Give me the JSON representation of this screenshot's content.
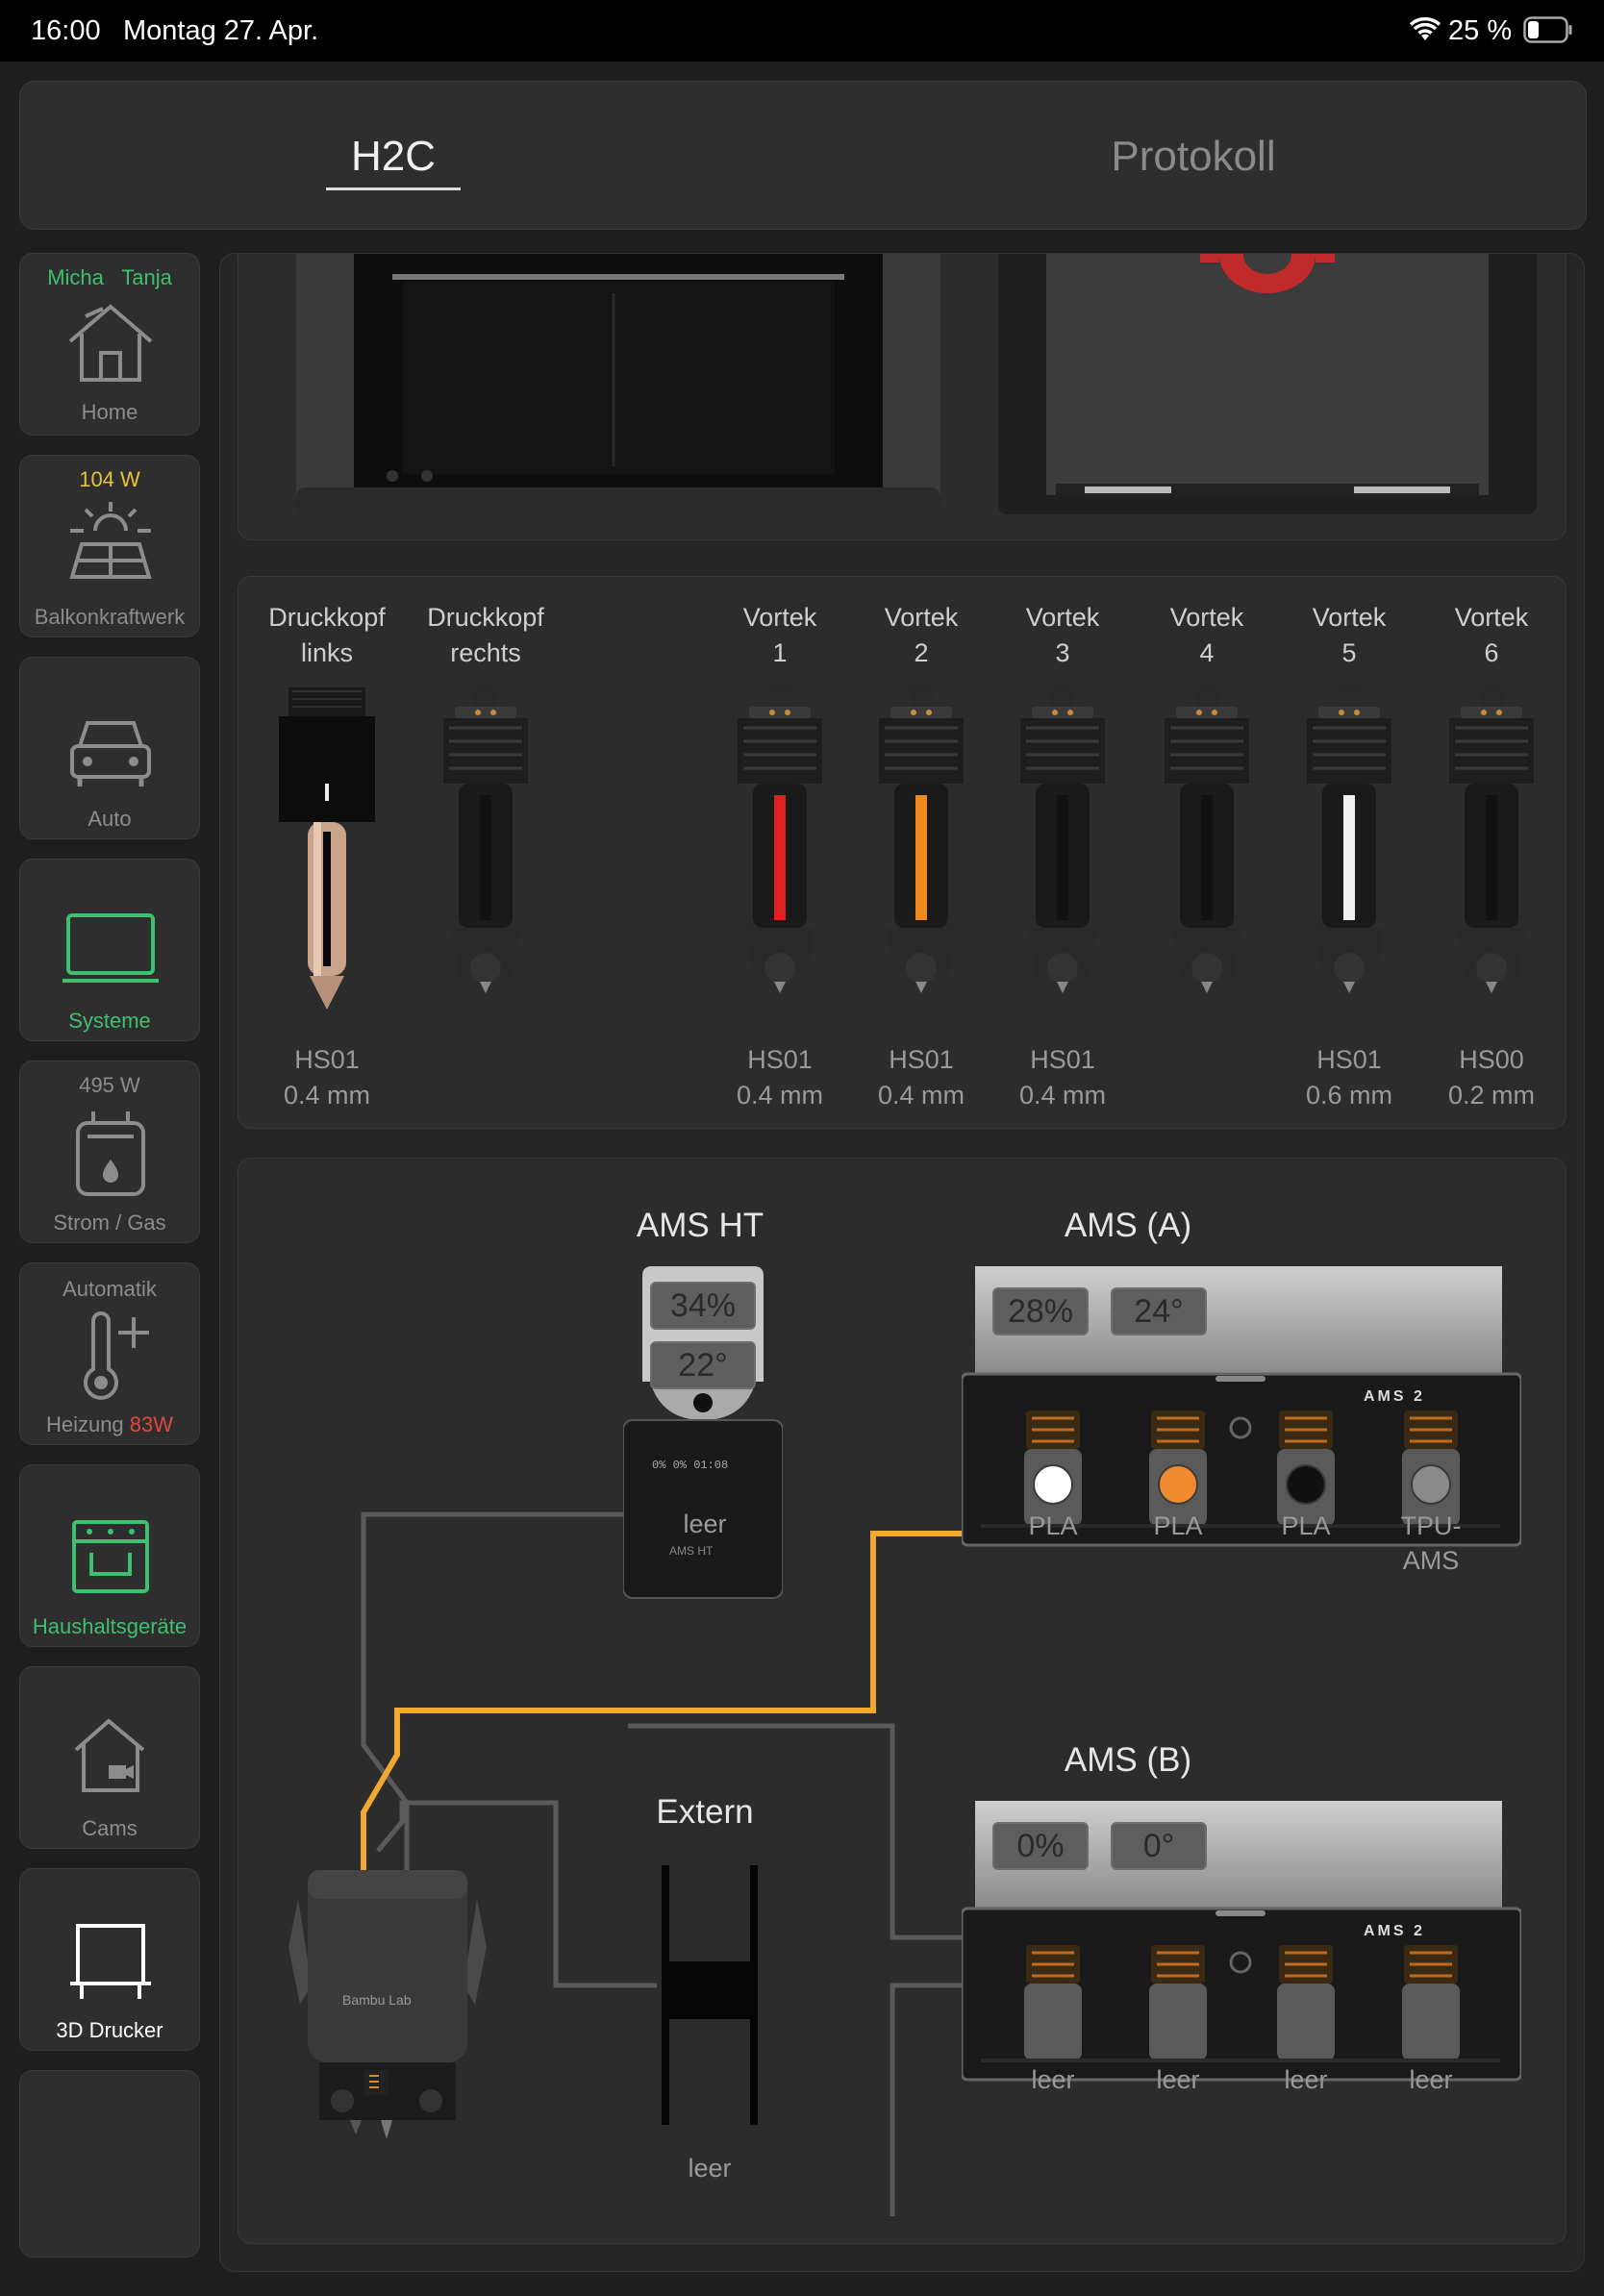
{
  "status_bar": {
    "time": "16:00",
    "date": "Montag 27. Apr.",
    "battery": "25 %"
  },
  "tabs": [
    {
      "label": "H2C",
      "active": true
    },
    {
      "label": "Protokoll",
      "active": false
    }
  ],
  "sidebar": {
    "home": {
      "user1": "Micha",
      "user2": "Tanja",
      "label": "Home"
    },
    "balkon": {
      "value": "104 W",
      "label": "Balkonkraftwerk"
    },
    "auto": {
      "label": "Auto"
    },
    "systeme": {
      "label": "Systeme"
    },
    "strom": {
      "value": "495 W",
      "label": "Strom / Gas"
    },
    "heizung": {
      "top": "Automatik",
      "label": "Heizung",
      "value": "83W"
    },
    "haushalt": {
      "label": "Haushaltsgeräte"
    },
    "cams": {
      "label": "Cams"
    },
    "drucker": {
      "label": "3D Drucker"
    }
  },
  "nozzles": [
    {
      "line1": "Druckkopf",
      "line2": "links",
      "type": "HS01",
      "size": "0.4 mm",
      "filament": null
    },
    {
      "line1": "Druckkopf",
      "line2": "rechts",
      "type": "",
      "size": "",
      "filament": "#111111"
    },
    {
      "line1": "Vortek",
      "line2": "1",
      "type": "HS01",
      "size": "0.4 mm",
      "filament": "#e02020"
    },
    {
      "line1": "Vortek",
      "line2": "2",
      "type": "HS01",
      "size": "0.4 mm",
      "filament": "#f08a20"
    },
    {
      "line1": "Vortek",
      "line2": "3",
      "type": "HS01",
      "size": "0.4 mm",
      "filament": "#111111"
    },
    {
      "line1": "Vortek",
      "line2": "4",
      "type": "",
      "size": "",
      "filament": "#111111"
    },
    {
      "line1": "Vortek",
      "line2": "5",
      "type": "HS01",
      "size": "0.6 mm",
      "filament": "#f0f0f0"
    },
    {
      "line1": "Vortek",
      "line2": "6",
      "type": "HS00",
      "size": "0.2 mm",
      "filament": "#111111"
    }
  ],
  "ams_ht": {
    "title": "AMS HT",
    "humidity": "34%",
    "temp": "22°",
    "slot": "leer"
  },
  "ams_a": {
    "title": "AMS (A)",
    "humidity": "28%",
    "temp": "24°",
    "slots": [
      {
        "label": "PLA",
        "color": "#ffffff"
      },
      {
        "label": "PLA",
        "color": "#f08a30"
      },
      {
        "label": "PLA",
        "color": "#111111"
      },
      {
        "label": "TPU-\nAMS",
        "color": "#8a8a8a"
      }
    ]
  },
  "ams_b": {
    "title": "AMS (B)",
    "humidity": "0%",
    "temp": "0°",
    "slots": [
      {
        "label": "leer"
      },
      {
        "label": "leer"
      },
      {
        "label": "leer"
      },
      {
        "label": "leer"
      }
    ]
  },
  "extern": {
    "title": "Extern",
    "slot": "leer"
  },
  "device_brand": "Bambu Lab",
  "ams_brand": "AMS 2",
  "ams_ht_brand": "AMS HT",
  "colors": {
    "accent_green": "#3fbf6f",
    "accent_yellow": "#e8c23a",
    "heat_red": "#e0483a",
    "path_active": "#f0a830",
    "path_idle": "#5a5a5a"
  }
}
